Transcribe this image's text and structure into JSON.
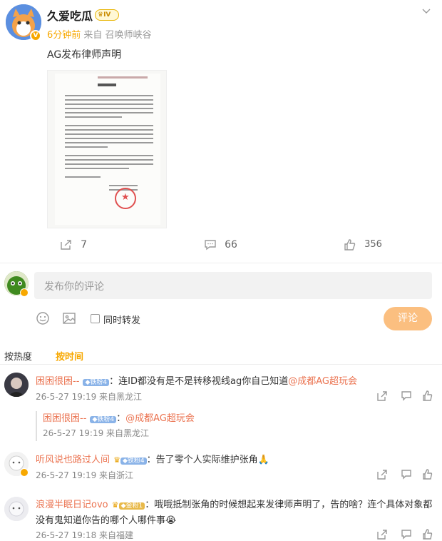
{
  "post": {
    "author": "久爱吃瓜",
    "level_badge": "IV",
    "verified_badge": "V",
    "time": "6分钟前",
    "source": "来自 召唤师峡谷",
    "text": "AG发布律师声明",
    "image_alt_lines": [
      "律师声明"
    ],
    "actions": {
      "repost": "7",
      "comment": "66",
      "like": "356"
    }
  },
  "composer": {
    "placeholder": "发布你的评论",
    "repost_label": "同时转发",
    "submit_label": "评论"
  },
  "sort_tabs": {
    "hot": "按热度",
    "time": "按时间"
  },
  "comments": [
    {
      "name": "困困很困--",
      "badge": "铁粉4",
      "text": "：连ID都没有是不是转移视线ag你自己知道",
      "mention": "@成都AG超玩会",
      "meta": "26-5-27 19:19 来自黑龙江"
    },
    {
      "name": "困困很困--",
      "badge": "铁粉4",
      "text": "：",
      "mention": "@成都AG超玩会",
      "meta": "26-5-27 19:19 来自黑龙江"
    },
    {
      "name": "听风说也路过人间",
      "badge": "铁粉4",
      "text": "：告了零个人实际维护张角🙏",
      "mention": "",
      "meta": "26-5-27 19:19 来自浙江"
    },
    {
      "name": "浪漫半眠日记ovo",
      "badge": "金粉1",
      "text": "：哦哦抵制张角的时候想起来发律师声明了，告的啥？连个具体对象都",
      "text2": "没有鬼知道你告的哪个人哪件事😭",
      "mention": "",
      "meta": "26-5-27 19:18 来自福建"
    }
  ],
  "colors": {
    "accent": "#f7a800",
    "name": "#eb7350",
    "submit": "#fbbf80"
  }
}
